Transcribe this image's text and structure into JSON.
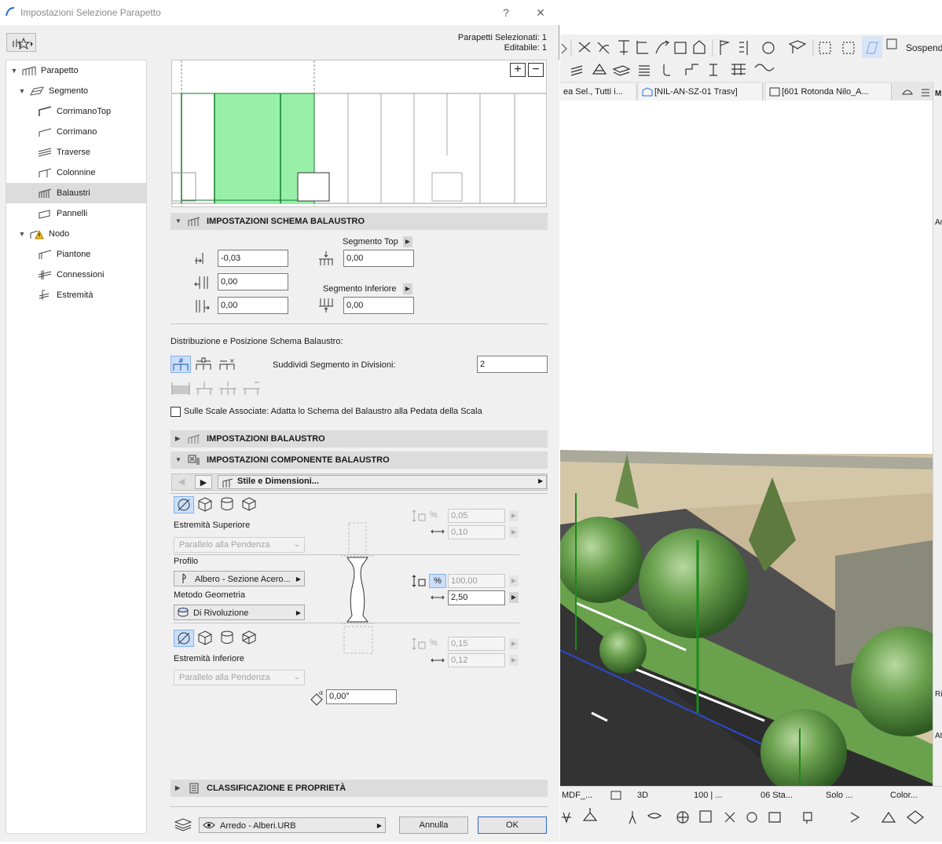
{
  "dialog": {
    "title": "Impostazioni Selezione Parapetto",
    "help_label": "?",
    "close_label": "✕",
    "selected_label": "Parapetti Selezionati: 1",
    "editable_label": "Editabile: 1"
  },
  "tree": [
    {
      "label": "Parapetto"
    },
    {
      "label": "Segmento"
    },
    {
      "label": "CorrimanoTop"
    },
    {
      "label": "Corrimano"
    },
    {
      "label": "Traverse"
    },
    {
      "label": "Colonnine"
    },
    {
      "label": "Balaustri"
    },
    {
      "label": "Pannelli"
    },
    {
      "label": "Nodo"
    },
    {
      "label": "Piantone"
    },
    {
      "label": "Connessioni"
    },
    {
      "label": "Estremità"
    }
  ],
  "preview": {
    "zoom_in": "+",
    "zoom_out": "−"
  },
  "schema": {
    "title": "IMPOSTAZIONI SCHEMA BALAUSTRO",
    "left_values": [
      "-0,03",
      "0,00",
      "0,00"
    ],
    "segment_top_label": "Segmento Top",
    "segment_top_value": "0,00",
    "segment_bottom_label": "Segmento Inferiore",
    "segment_bottom_value": "0,00"
  },
  "distribution": {
    "title": "Distribuzione e Posizione Schema Balaustro:",
    "divide_label": "Suddividi Segmento in Divisioni:",
    "divide_value": "2",
    "stairs_label": "Sulle Scale Associate: Adatta lo Schema del Balaustro alla Pedata della Scala"
  },
  "balaustro_section": {
    "title": "IMPOSTAZIONI BALAUSTRO"
  },
  "component_section": {
    "title": "IMPOSTAZIONI COMPONENTE BALAUSTRO"
  },
  "component": {
    "style_label": "Stile e Dimensioni...",
    "top_end_label": "Estremità Superiore",
    "top_end_value": "Parallelo alla Pendenza",
    "profile_label": "Profilo",
    "profile_value": "Albero - Sezione Acero...",
    "geometry_label": "Metodo Geometria",
    "geometry_value": "Di Rivoluzione",
    "bottom_end_label": "Estremità Inferiore",
    "bottom_end_value": "Parallelo alla Pendenza",
    "angle_value": "0,00°",
    "top_values": [
      "0,05",
      "0,10"
    ],
    "mid_values": [
      "100,00",
      "2,50"
    ],
    "bottom_values": [
      "0,15",
      "0,12"
    ],
    "percent_symbol": "%"
  },
  "classification": {
    "title": "CLASSIFICAZIONE E PROPRIETÀ"
  },
  "footer": {
    "layer_value": "Arredo - Alberi.URB",
    "cancel_label": "Annulla",
    "ok_label": "OK"
  },
  "app": {
    "suspend_label": "Sospend",
    "tabs": [
      "ea Sel., Tutti i...",
      "[NIL-AN-SZ-01 Trasv]",
      "[601 Rotonda Nilo_A..."
    ],
    "status_items": [
      "MDF_...",
      "3D",
      "100 | ...",
      "06 Sta...",
      "Solo ...",
      "Color..."
    ],
    "right_letters": [
      "M",
      "Ar",
      "Ri",
      "At"
    ]
  },
  "colors": {
    "accent": "#2a6bd6",
    "highlight": "#c9defa",
    "preview_fill": "#98f0a8"
  }
}
